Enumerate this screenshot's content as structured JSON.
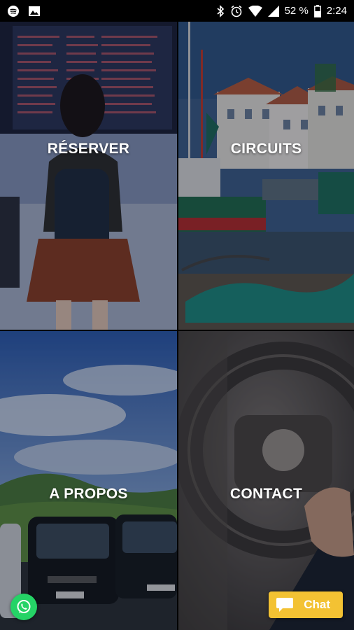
{
  "status_bar": {
    "battery": "52 %",
    "time": "2:24",
    "icons": [
      "spotify-icon",
      "image-icon",
      "bluetooth-icon",
      "alarm-icon",
      "wifi-icon",
      "signal-icon",
      "battery-icon"
    ]
  },
  "tiles": [
    {
      "label": "RÉSERVER"
    },
    {
      "label": "CIRCUITS"
    },
    {
      "label": "A PROPOS"
    },
    {
      "label": "CONTACT"
    }
  ],
  "whatsapp": {
    "icon": "whatsapp-icon"
  },
  "chat": {
    "label": "Chat",
    "icon": "chat-bubble-icon"
  },
  "colors": {
    "chat_button": "#f3c233",
    "whatsapp": "#25d366"
  }
}
